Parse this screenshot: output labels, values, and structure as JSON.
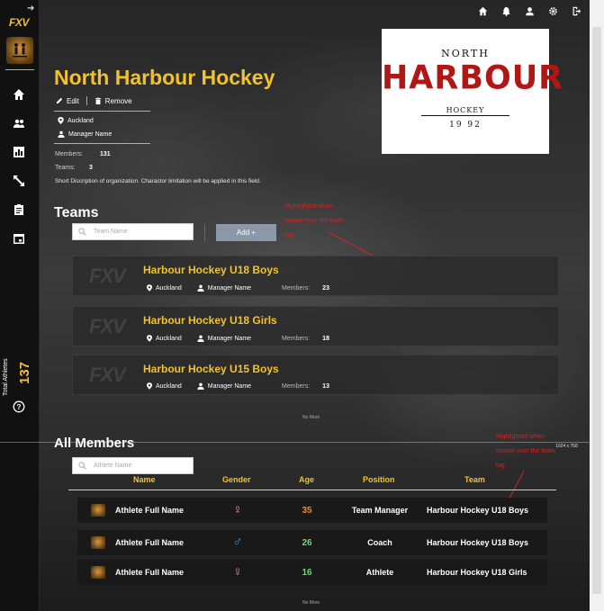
{
  "colors": {
    "accent": "#f2c12e",
    "annotation": "#d42424",
    "female": "#e88aa8",
    "male": "#3a8fd8",
    "age_orange": "#f08a30",
    "age_green": "#7ed07a",
    "add_button": "#8a98a8"
  },
  "sidebar": {
    "logo": "FXV",
    "total_label": "Total Athletes",
    "total_value": "137",
    "nav_icons": [
      "home-icon",
      "people-icon",
      "bar-chart-icon",
      "expand-icon",
      "clipboard-icon",
      "calendar-icon"
    ],
    "help_icon": "help-icon"
  },
  "topbar": {
    "icons": [
      "home-icon",
      "bell-icon",
      "user-icon",
      "gear-icon",
      "logout-icon"
    ]
  },
  "org": {
    "name": "North Harbour Hockey",
    "edit_label": "Edit",
    "remove_label": "Remove",
    "location": "Auckland",
    "manager": "Manager Name",
    "members_label": "Members:",
    "members_value": "131",
    "teams_label": "Teams:",
    "teams_value": "3",
    "description": "Short Discription of organization. Charactor limitation will be applied in this field."
  },
  "org_logo": {
    "line1": "NORTH",
    "line2": "HARBOUR",
    "line3": "HOCKEY",
    "line4": "19 92"
  },
  "teams": {
    "title": "Teams",
    "search_placeholder": "Team Name",
    "add_label": "Add +",
    "annotation": [
      "Highlighted    when",
      "mouse over the team",
      "tag"
    ],
    "members_label": "Members:",
    "items": [
      {
        "name": "Harbour Hockey U18 Boys",
        "location": "Auckland",
        "manager": "Manager Name",
        "members": "23"
      },
      {
        "name": "Harbour Hockey U18 Girls",
        "location": "Auckland",
        "manager": "Manager Name",
        "members": "18"
      },
      {
        "name": "Harbour Hockey U15 Boys",
        "location": "Auckland",
        "manager": "Manager Name",
        "members": "13"
      }
    ],
    "no_more": "No More"
  },
  "resolution_label": "1024 x 768",
  "members": {
    "title": "All Members",
    "search_placeholder": "Athlete Name",
    "annotation": [
      "Highlighted    when",
      "mouse over the team",
      "tag"
    ],
    "columns": [
      "Name",
      "Gender",
      "Age",
      "Position",
      "Team"
    ],
    "rows": [
      {
        "name": "Athlete Full Name",
        "gender": "♀",
        "age": "35",
        "position": "Team Manager",
        "team": "Harbour Hockey U18 Boys"
      },
      {
        "name": "Athlete Full Name",
        "gender": "♂",
        "age": "26",
        "position": "Coach",
        "team": "Harbour Hockey U18 Boys"
      },
      {
        "name": "Athlete Full Name",
        "gender": "♀",
        "age": "16",
        "position": "Athlete",
        "team": "Harbour Hockey U18 Girls"
      }
    ],
    "no_more": "No More"
  }
}
